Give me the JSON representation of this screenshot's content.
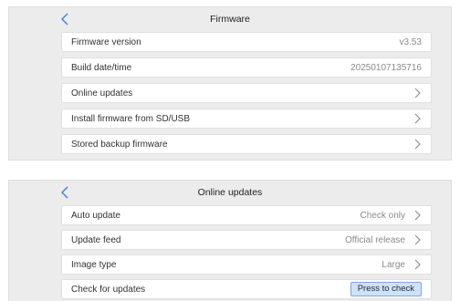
{
  "firmware": {
    "title": "Firmware",
    "rows": [
      {
        "label": "Firmware version",
        "value": "v3.53"
      },
      {
        "label": "Build date/time",
        "value": "20250107135716"
      },
      {
        "label": "Online updates"
      },
      {
        "label": "Install firmware from SD/USB"
      },
      {
        "label": "Stored backup firmware"
      }
    ]
  },
  "online_updates": {
    "title": "Online updates",
    "rows": [
      {
        "label": "Auto update",
        "value": "Check only"
      },
      {
        "label": "Update feed",
        "value": "Official release"
      },
      {
        "label": "Image type",
        "value": "Large"
      },
      {
        "label": "Check for updates",
        "button": "Press to check"
      }
    ]
  },
  "icons": {
    "back": "chevron-left-icon",
    "row_arrow": "chevron-right-icon"
  },
  "colors": {
    "accent": "#3b7ddd",
    "panel_bg": "#ececec",
    "button_bg": "#cfe1f7"
  }
}
